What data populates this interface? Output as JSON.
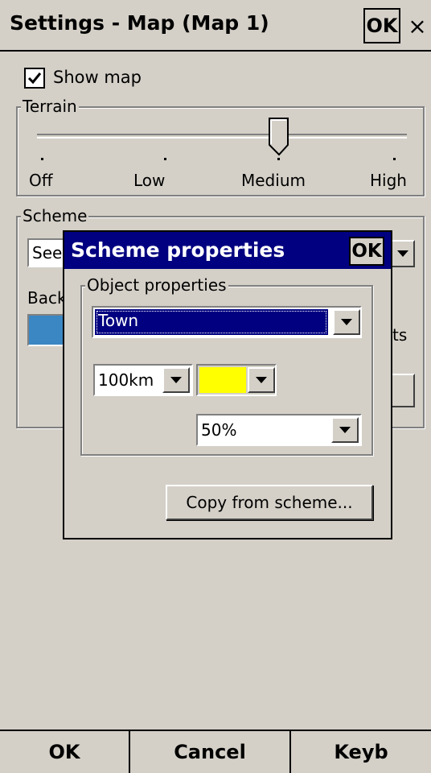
{
  "window": {
    "title": "Settings - Map (Map 1)",
    "ok_label": "OK",
    "close_label": "×"
  },
  "show_map": {
    "label": "Show map",
    "checked": true
  },
  "terrain": {
    "group_label": "Terrain",
    "levels": [
      "Off",
      "Low",
      "Medium",
      "High"
    ],
    "selected": "Medium"
  },
  "scheme": {
    "group_label": "Scheme",
    "selected_value": "See",
    "background_label": "Back",
    "partial_text": "ts"
  },
  "dialog": {
    "title": "Scheme properties",
    "ok_label": "OK",
    "object_group_label": "Object properties",
    "object_selected": "Town",
    "range_value": "100km",
    "color_value": "#ffff00",
    "opacity_value": "50%",
    "copy_button": "Copy from scheme..."
  },
  "bottom": {
    "ok": "OK",
    "cancel": "Cancel",
    "keyb": "Keyb"
  },
  "colors": {
    "title_bar": "#000080",
    "scheme_swatch": "#3a87c4",
    "selection": "#000080"
  }
}
